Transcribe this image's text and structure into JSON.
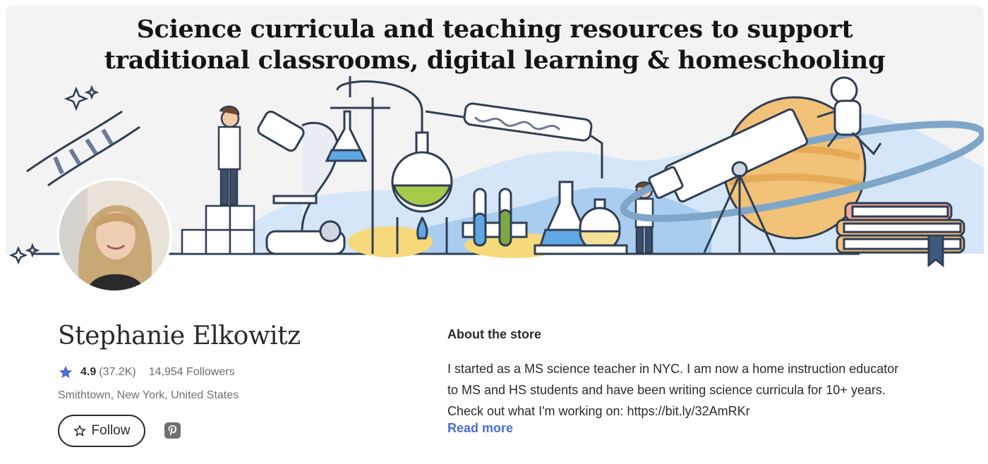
{
  "banner": {
    "title_line1": "Science curricula and teaching resources to support",
    "title_line2": "traditional classrooms, digital learning & homeschooling"
  },
  "seller": {
    "name": "Stephanie Elkowitz",
    "rating": "4.9",
    "rating_count": "(37.2K)",
    "followers": "14,954 Followers",
    "location": "Smithtown, New York, United States",
    "follow_label": "Follow"
  },
  "about": {
    "title": "About the store",
    "line1": "I started as a MS science teacher in NYC. I am now a home instruction educator",
    "line2": "to MS and HS students and have been writing science curricula for 10+ years.",
    "line3": "Check out what I'm working on: https://bit.ly/32AmRKr",
    "read_more": "Read more"
  },
  "colors": {
    "accent_blue": "#4a6fd1",
    "star": "#4a6fd1",
    "banner_bg": "#f3f3f3"
  },
  "icons": [
    "star-icon",
    "star-outline-icon",
    "pinterest-icon",
    "dna-icon",
    "sparkle-icon",
    "microscope-icon",
    "telescope-icon",
    "flask-icon",
    "books-icon",
    "astronaut-icon"
  ]
}
